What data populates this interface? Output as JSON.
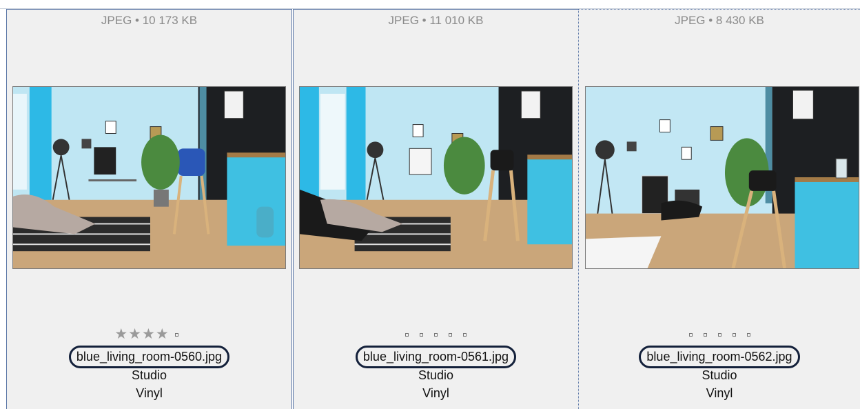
{
  "items": [
    {
      "meta": "JPEG • 10 173 KB",
      "rating": 4,
      "filename": "blue_living_room-0560.jpg",
      "line2": "Studio",
      "line3": "Vinyl"
    },
    {
      "meta": "JPEG • 11 010 KB",
      "rating": 0,
      "filename": "blue_living_room-0561.jpg",
      "line2": "Studio",
      "line3": "Vinyl"
    },
    {
      "meta": "JPEG • 8 430 KB",
      "rating": 0,
      "filename": "blue_living_room-0562.jpg",
      "line2": "Studio",
      "line3": "Vinyl"
    }
  ],
  "colors": {
    "wall": "#b8e3f2",
    "accent": "#3bbde0",
    "dark_wall": "#1d1f22",
    "floor": "#c9a77c",
    "selection_outline": "#13203a"
  }
}
